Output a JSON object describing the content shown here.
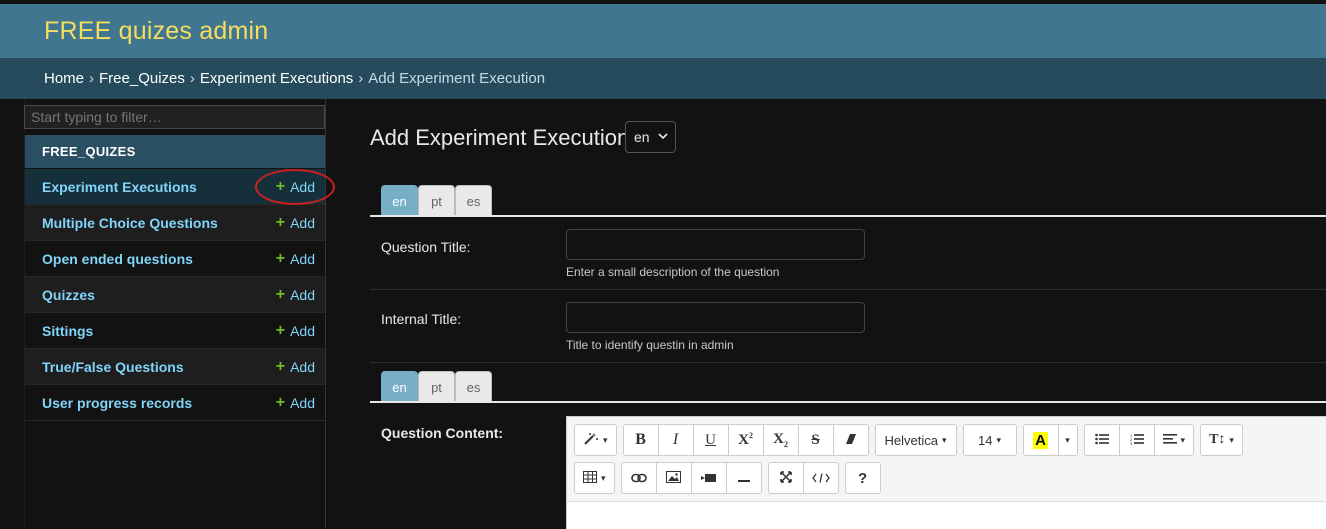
{
  "header": {
    "title": "FREE quizes admin"
  },
  "breadcrumbs": {
    "home": "Home",
    "app": "Free_Quizes",
    "model": "Experiment Executions",
    "current": "Add Experiment Execution",
    "separator": "›"
  },
  "sidebar": {
    "filter_placeholder": "Start typing to filter…",
    "app_caption": "FREE_QUIZES",
    "add_label": "Add",
    "add_symbol": "+",
    "items": [
      {
        "label": "Experiment Executions"
      },
      {
        "label": "Multiple Choice Questions"
      },
      {
        "label": "Open ended questions"
      },
      {
        "label": "Quizzes"
      },
      {
        "label": "Sittings"
      },
      {
        "label": "True/False Questions"
      },
      {
        "label": "User progress records"
      }
    ]
  },
  "main": {
    "title": "Add Experiment Execution",
    "language_select": {
      "value": "en",
      "chevron": "⌄"
    },
    "tabs": [
      "en",
      "pt",
      "es"
    ],
    "fields": [
      {
        "label": "Question Title:",
        "help": "Enter a small description of the question",
        "value": ""
      },
      {
        "label": "Internal Title:",
        "help": "Title to identify questin in admin",
        "value": ""
      }
    ],
    "content_label": "Question Content:",
    "editor": {
      "font": "Helvetica",
      "size": "14",
      "highlight": "A"
    }
  },
  "colors": {
    "header_bg": "#417690",
    "brand": "#f5dd5d",
    "breadcrumb_bg": "#264b5d",
    "link": "#81d4fa",
    "add_plus": "#70bf2b",
    "active_tab": "#79aec8",
    "annotation_circle": "#cc1f1f"
  }
}
